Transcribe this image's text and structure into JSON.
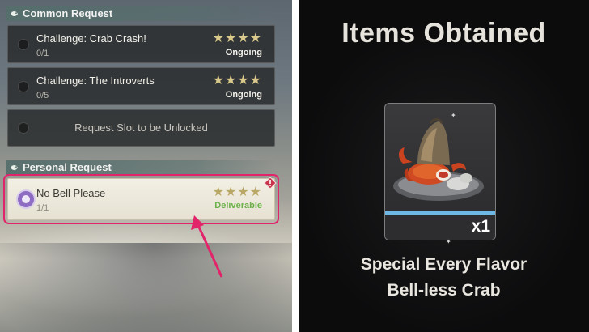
{
  "left_panel": {
    "common_header": "Common Request",
    "common_requests": [
      {
        "title": "Challenge: Crab Crash!",
        "progress": "0/1",
        "stars": "★★★★",
        "status": "Ongoing"
      },
      {
        "title": "Challenge: The Introverts",
        "progress": "0/5",
        "stars": "★★★★",
        "status": "Ongoing"
      }
    ],
    "locked_slot": "Request Slot to be Unlocked",
    "personal_header": "Personal Request",
    "personal_request": {
      "title": "No Bell Please",
      "progress": "1/1",
      "stars": "★★★★",
      "status": "Deliverable"
    },
    "colors": {
      "highlight": "#e2246a",
      "deliverable": "#6cb14b",
      "stars": "#d9c98a"
    }
  },
  "right_panel": {
    "title": "Items Obtained",
    "item": {
      "quantity": "x1",
      "name_line1": "Special Every Flavor",
      "name_line2": "Bell-less Crab",
      "rarity_color": "#6fb8e6"
    }
  }
}
